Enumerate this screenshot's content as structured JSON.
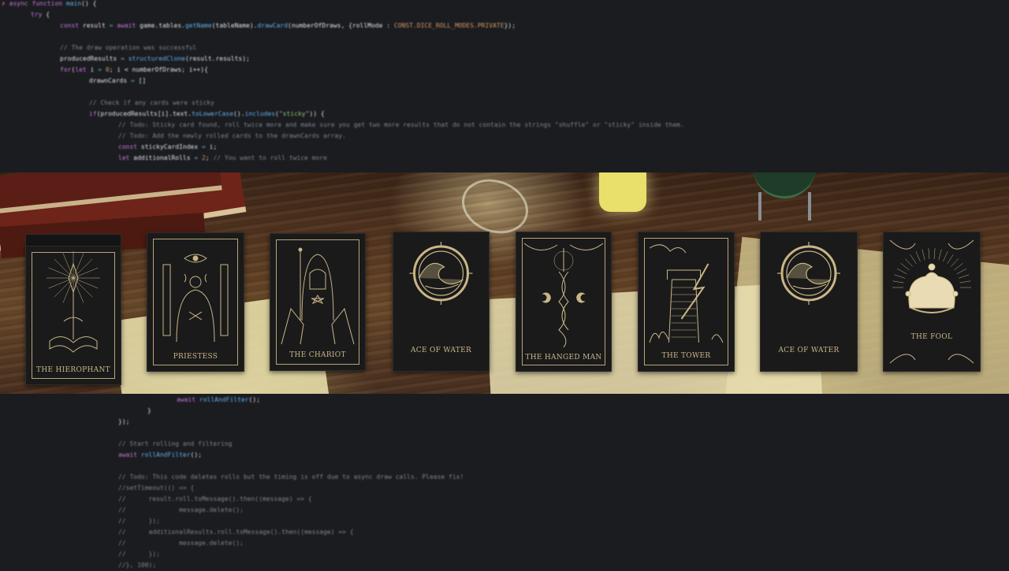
{
  "code_top": [
    {
      "indent": 0,
      "tokens": [
        [
          "c-red",
          "✗ "
        ],
        [
          "c-kw",
          "async function "
        ],
        [
          "c-fn",
          "main"
        ],
        [
          "c-var",
          "() {"
        ]
      ]
    },
    {
      "indent": 1,
      "tokens": [
        [
          "c-kw",
          "try "
        ],
        [
          "c-var",
          "{"
        ]
      ]
    },
    {
      "indent": 2,
      "tokens": [
        [
          "c-kw",
          "const "
        ],
        [
          "c-var",
          "result "
        ],
        [
          "c-op",
          "= "
        ],
        [
          "c-kw",
          "await "
        ],
        [
          "c-var",
          "game.tables."
        ],
        [
          "c-fn",
          "getName"
        ],
        [
          "c-var",
          "(tableName)."
        ],
        [
          "c-fn",
          "drawCard"
        ],
        [
          "c-var",
          "(numberOfDraws, {rollMode : "
        ],
        [
          "c-num",
          "CONST.DICE_ROLL_MODES.PRIVATE"
        ],
        [
          "c-var",
          "});"
        ]
      ]
    },
    {
      "indent": 0,
      "tokens": []
    },
    {
      "indent": 2,
      "tokens": [
        [
          "c-com",
          "// The draw operation was successful"
        ]
      ]
    },
    {
      "indent": 2,
      "tokens": [
        [
          "c-var",
          "producedResults "
        ],
        [
          "c-op",
          "= "
        ],
        [
          "c-fn",
          "structuredClone"
        ],
        [
          "c-var",
          "(result.results);"
        ]
      ]
    },
    {
      "indent": 2,
      "tokens": [
        [
          "c-kw",
          "for"
        ],
        [
          "c-var",
          "("
        ],
        [
          "c-kw",
          "let "
        ],
        [
          "c-var",
          "i "
        ],
        [
          "c-op",
          "= "
        ],
        [
          "c-num",
          "0"
        ],
        [
          "c-var",
          "; i < numberOfDraws; i++){"
        ]
      ]
    },
    {
      "indent": 3,
      "tokens": [
        [
          "c-var",
          "drawnCards "
        ],
        [
          "c-op",
          "= "
        ],
        [
          "c-var",
          "[]"
        ]
      ]
    },
    {
      "indent": 0,
      "tokens": []
    },
    {
      "indent": 3,
      "tokens": [
        [
          "c-com",
          "// Check if any cards were sticky"
        ]
      ]
    },
    {
      "indent": 3,
      "tokens": [
        [
          "c-kw",
          "if"
        ],
        [
          "c-var",
          "(producedResults[i].text."
        ],
        [
          "c-fn",
          "toLowerCase"
        ],
        [
          "c-var",
          "()."
        ],
        [
          "c-fn",
          "includes"
        ],
        [
          "c-var",
          "("
        ],
        [
          "c-str",
          "\"sticky\""
        ],
        [
          "c-var",
          ")) {"
        ]
      ]
    },
    {
      "indent": 4,
      "tokens": [
        [
          "c-com",
          "// Todo: Sticky card found, roll twice more and make sure you get two more results that do not contain the strings \"shuffle\" or \"sticky\" inside them."
        ]
      ]
    },
    {
      "indent": 4,
      "tokens": [
        [
          "c-com",
          "// Todo: Add the newly rolled cards to the drawnCards array."
        ]
      ]
    },
    {
      "indent": 4,
      "tokens": [
        [
          "c-kw",
          "const "
        ],
        [
          "c-var",
          "stickyCardIndex "
        ],
        [
          "c-op",
          "= "
        ],
        [
          "c-var",
          "i;"
        ]
      ]
    },
    {
      "indent": 4,
      "tokens": [
        [
          "c-kw",
          "let "
        ],
        [
          "c-var",
          "additionalRolls "
        ],
        [
          "c-op",
          "= "
        ],
        [
          "c-num",
          "2"
        ],
        [
          "c-var",
          "; "
        ],
        [
          "c-com",
          "// You want to roll twice more"
        ]
      ]
    }
  ],
  "code_bottom": [
    {
      "indent": 6,
      "tokens": [
        [
          "c-kw",
          "await "
        ],
        [
          "c-fn",
          "rollAndFilter"
        ],
        [
          "c-var",
          "();"
        ]
      ]
    },
    {
      "indent": 5,
      "tokens": [
        [
          "c-var",
          "}"
        ]
      ]
    },
    {
      "indent": 4,
      "tokens": [
        [
          "c-var",
          "});"
        ]
      ]
    },
    {
      "indent": 0,
      "tokens": []
    },
    {
      "indent": 4,
      "tokens": [
        [
          "c-com",
          "// Start rolling and filtering"
        ]
      ]
    },
    {
      "indent": 4,
      "tokens": [
        [
          "c-kw",
          "await "
        ],
        [
          "c-fn",
          "rollAndFilter"
        ],
        [
          "c-var",
          "();"
        ]
      ]
    },
    {
      "indent": 0,
      "tokens": []
    },
    {
      "indent": 4,
      "tokens": [
        [
          "c-com",
          "// Todo: This code deletes rolls but the timing is off due to async draw calls. Please fix!"
        ]
      ]
    },
    {
      "indent": 4,
      "tokens": [
        [
          "c-com",
          "//setTimeout(() => {"
        ]
      ]
    },
    {
      "indent": 4,
      "tokens": [
        [
          "c-com",
          "//      result.roll.toMessage().then((message) => {"
        ]
      ]
    },
    {
      "indent": 4,
      "tokens": [
        [
          "c-com",
          "//              message.delete();"
        ]
      ]
    },
    {
      "indent": 4,
      "tokens": [
        [
          "c-com",
          "//      });"
        ]
      ]
    },
    {
      "indent": 4,
      "tokens": [
        [
          "c-com",
          "//      additionalResults.roll.toMessage().then((message) => {"
        ]
      ]
    },
    {
      "indent": 4,
      "tokens": [
        [
          "c-com",
          "//              message.delete();"
        ]
      ]
    },
    {
      "indent": 4,
      "tokens": [
        [
          "c-com",
          "//      });"
        ]
      ]
    },
    {
      "indent": 4,
      "tokens": [
        [
          "c-com",
          "//}, 100);"
        ]
      ]
    }
  ],
  "cards": [
    {
      "id": "hierophant",
      "title": "THE HIEROPHANT",
      "art": "hierophant"
    },
    {
      "id": "priestess",
      "title": "PRIESTESS",
      "art": "priestess"
    },
    {
      "id": "chariot",
      "title": "THE CHARIOT",
      "art": "chariot"
    },
    {
      "id": "ace-of-water-1",
      "title": "ACE OF WATER",
      "art": "wave"
    },
    {
      "id": "hanged-man",
      "title": "THE HANGED MAN",
      "art": "hanged"
    },
    {
      "id": "tower",
      "title": "THE TOWER",
      "art": "tower"
    },
    {
      "id": "ace-of-water-2",
      "title": "ACE OF WATER",
      "art": "wave"
    },
    {
      "id": "fool",
      "title": "THE FOOL",
      "art": "fool"
    }
  ],
  "colors": {
    "background": "#1b1c1f",
    "card_gold": "#c9b685",
    "card_black": "#1a1a1b"
  }
}
